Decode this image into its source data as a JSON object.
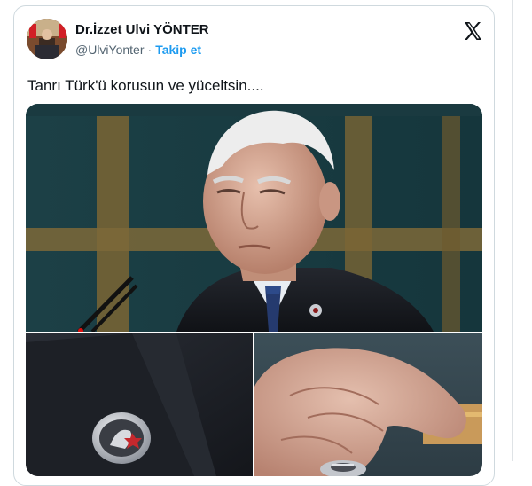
{
  "tweet": {
    "display_name": "Dr.İzzet Ulvi YÖNTER",
    "handle": "@UlviYonter",
    "separator": "·",
    "follow_label": "Takip et",
    "text": "Tanrı Türk'ü korusun ve yüceltsin....",
    "platform_icon": "x-logo-icon"
  },
  "colors": {
    "accent": "#1d9bf0",
    "text": "#0f1419",
    "muted": "#536471",
    "border": "#cfd9de"
  }
}
